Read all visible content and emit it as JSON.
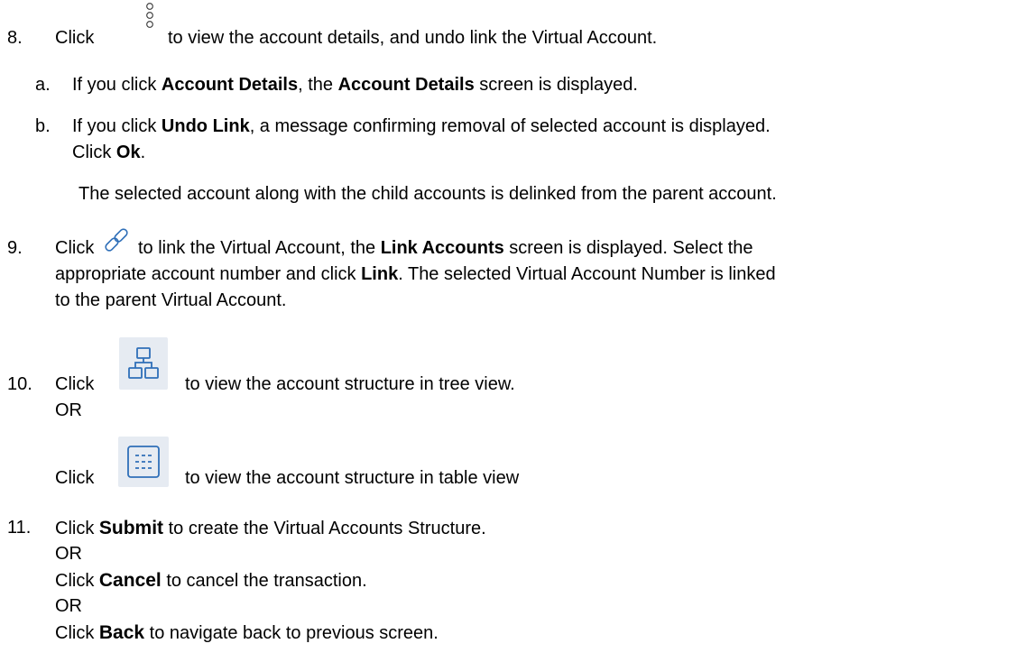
{
  "step8": {
    "number": "8.",
    "click": "Click",
    "icon": "kebab-vertical-icon",
    "rest": "to view the account details, and undo link the Virtual Account.",
    "a": {
      "marker": "a.",
      "pre": "If you click ",
      "bold1": "Account Details",
      "mid": ", the ",
      "bold2": "Account Details",
      "post": " screen is displayed."
    },
    "b": {
      "marker": "b.",
      "pre": "If you click ",
      "bold1": "Undo Link",
      "post": ", a message confirming removal of selected account is displayed.",
      "line2_pre": "Click ",
      "line2_bold": "Ok",
      "line2_post": "."
    },
    "note": "The selected account along with the child accounts is delinked from the parent account."
  },
  "step9": {
    "number": "9.",
    "click": "Click",
    "icon": "link-icon",
    "line1_pre": "to link the Virtual Account, the ",
    "line1_bold": "Link Accounts",
    "line1_post": " screen is displayed. Select the",
    "line2_pre": "appropriate account number and click ",
    "line2_bold": "Link",
    "line2_post": ". The selected Virtual Account Number is linked",
    "line3": "to the parent Virtual Account."
  },
  "step10": {
    "number": "10.",
    "click": "Click",
    "icon1": "tree-view-icon",
    "text1": "to view the account structure in tree view.",
    "or": "OR",
    "click2": "Click",
    "icon2": "table-view-icon",
    "text2": "to view the account structure in table view"
  },
  "step11": {
    "number": "11.",
    "line1_pre": "Click ",
    "line1_bold": "Submit",
    "line1_post": " to create the Virtual Accounts Structure.",
    "or1": "OR",
    "line2_pre": "Click ",
    "line2_bold": "Cancel",
    "line2_post": " to cancel the transaction.",
    "or2": "OR",
    "line3_pre": "Click ",
    "line3_bold": "Back",
    "line3_post": " to navigate back to previous screen."
  },
  "colors": {
    "text": "#000000",
    "icon_blue": "#2f6fb8",
    "icon_bg": "#e6ebf2"
  }
}
